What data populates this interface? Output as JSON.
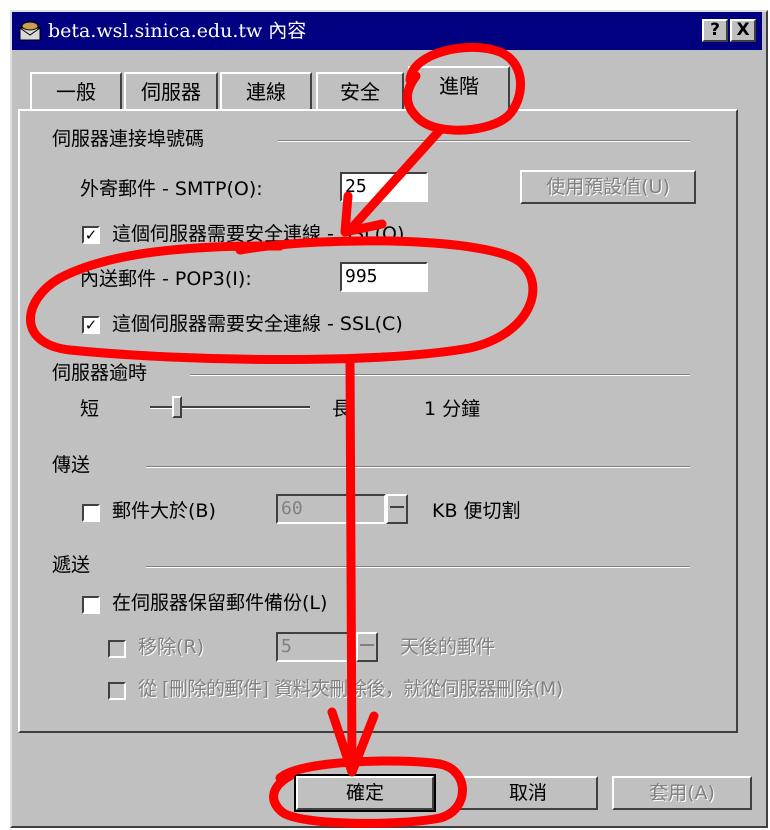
{
  "window": {
    "title": "beta.wsl.sinica.edu.tw 內容",
    "help_label": "?",
    "close_label": "X"
  },
  "tabs": [
    {
      "label": "一般"
    },
    {
      "label": "伺服器"
    },
    {
      "label": "連線"
    },
    {
      "label": "安全"
    },
    {
      "label": "進階",
      "active": true
    }
  ],
  "ports": {
    "section_label": "伺服器連接埠號碼",
    "smtp_label": "外寄郵件 - SMTP(O):",
    "smtp_value": "25",
    "default_button_label": "使用預設值(U)",
    "smtp_ssl_label": "這個伺服器需要安全連線 - SSL(Q)",
    "smtp_ssl_checked": true,
    "pop3_label": "內送郵件 - POP3(I):",
    "pop3_value": "995",
    "pop3_ssl_label": "這個伺服器需要安全連線 - SSL(C)",
    "pop3_ssl_checked": true
  },
  "timeout": {
    "section_label": "伺服器逾時",
    "short_label": "短",
    "long_label": "長",
    "value_label": "1 分鐘",
    "slider_level": 0.14
  },
  "sending": {
    "section_label": "傳送",
    "split_label": "郵件大於(B)",
    "split_checked": false,
    "split_value": "60",
    "split_unit_label": "KB 便切割"
  },
  "delivery": {
    "section_label": "遞送",
    "leave_copy_label": "在伺服器保留郵件備份(L)",
    "leave_copy_checked": false,
    "remove_label": "移除(R)",
    "remove_value": "5",
    "remove_unit_label": "天後的郵件",
    "remove_deleted_label": "從 [刪除的郵件] 資料夾刪除後，就從伺服器刪除(M)"
  },
  "buttons": {
    "ok_label": "確定",
    "cancel_label": "取消",
    "apply_label": "套用(A)"
  },
  "colors": {
    "titlebar": "#000080",
    "annotation": "#ff0000",
    "face": "#c0c0c0"
  }
}
